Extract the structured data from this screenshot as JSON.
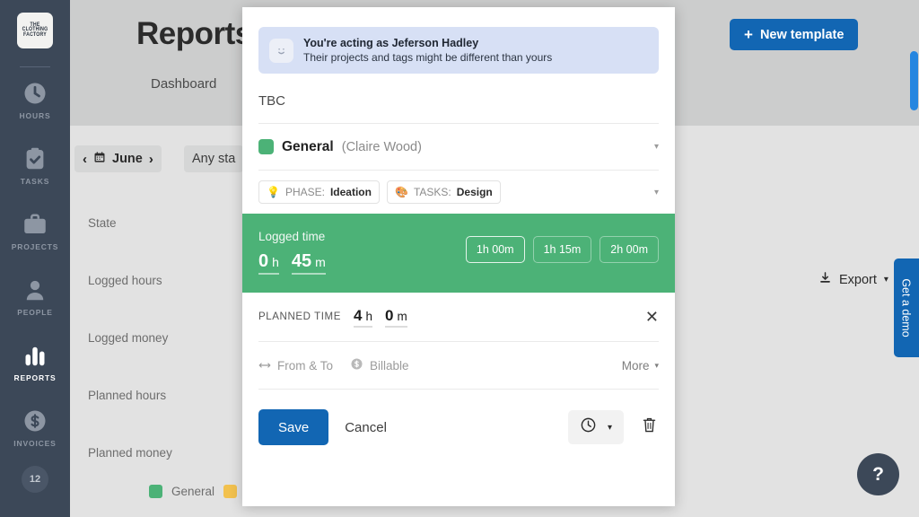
{
  "sidebar": {
    "logo": {
      "line1": "THE",
      "line2": "CLOTHING",
      "line3": "FACTORY"
    },
    "items": [
      {
        "label": "HOURS",
        "icon": "clock-icon",
        "active": false
      },
      {
        "label": "TASKS",
        "icon": "clipboard-check-icon",
        "active": false
      },
      {
        "label": "PROJECTS",
        "icon": "briefcase-icon",
        "active": false
      },
      {
        "label": "PEOPLE",
        "icon": "person-icon",
        "active": false
      },
      {
        "label": "REPORTS",
        "icon": "bar-chart-icon",
        "active": true
      },
      {
        "label": "INVOICES",
        "icon": "dollar-circle-icon",
        "active": false
      }
    ],
    "badge": "12"
  },
  "header": {
    "title": "Reports",
    "tab": "Dashboard",
    "new_template": "New template",
    "plus": "+"
  },
  "filters": {
    "prev": "‹",
    "next": "›",
    "month": "June",
    "state": "Any sta",
    "export": "Export",
    "export_caret": "▾"
  },
  "report_rows": [
    {
      "label": "State"
    },
    {
      "label": "Logged  hours"
    },
    {
      "label": "Logged  money"
    },
    {
      "label": "Planned  hours"
    },
    {
      "label": "Planned  money"
    }
  ],
  "legend": {
    "project": "General"
  },
  "right_rail": {
    "demo": "Get a demo",
    "help": "?"
  },
  "modal": {
    "impersonation": {
      "title": "You're acting as Jeferson Hadley",
      "subtitle": "Their projects and tags might be different than yours",
      "avatar_icon": "smiley-avatar-icon"
    },
    "note": "TBC",
    "project": {
      "name": "General",
      "owner": "(Claire Wood)",
      "color": "#4cb277",
      "caret": "▾"
    },
    "tags": [
      {
        "icon": "💡",
        "key": "PHASE:",
        "value": "Ideation"
      },
      {
        "icon": "🎨",
        "key": "TASKS:",
        "value": "Design"
      }
    ],
    "tags_caret": "▾",
    "logged": {
      "label": "Logged time",
      "hours": "0",
      "hours_unit": "h",
      "minutes": "45",
      "minutes_unit": "m",
      "presets": [
        "1h 00m",
        "1h 15m",
        "2h 00m"
      ],
      "color": "#4cb277"
    },
    "planned": {
      "label": "PLANNED TIME",
      "hours": "4",
      "hours_unit": "h",
      "minutes": "0",
      "minutes_unit": "m",
      "close": "✕"
    },
    "meta": {
      "from_to": "From & To",
      "from_to_icon": "arrows-horizontal-icon",
      "billable": "Billable",
      "billable_icon": "dollar-circle-icon",
      "more": "More",
      "more_caret": "▾"
    },
    "actions": {
      "save": "Save",
      "cancel": "Cancel",
      "timer_icon": "clock-icon",
      "timer_caret": "▾",
      "delete_icon": "trash-icon"
    }
  },
  "colors": {
    "accent_blue": "#1266b3",
    "green": "#4cb277",
    "sidebar": "#3c4858",
    "info_bg": "#d7e0f5"
  }
}
